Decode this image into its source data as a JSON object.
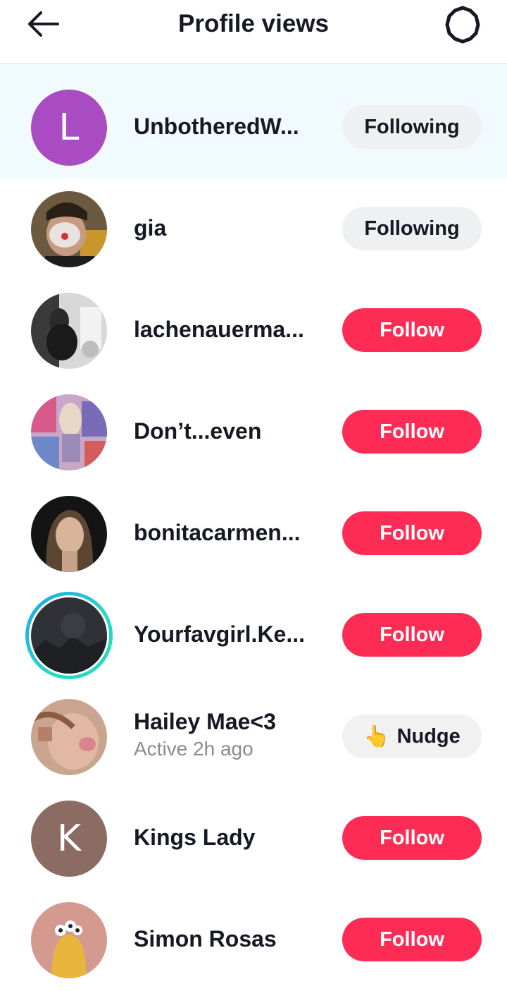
{
  "header": {
    "title": "Profile views",
    "back_icon": "back-arrow-icon",
    "settings_icon": "gear-icon"
  },
  "colors": {
    "follow": "#fe2c55",
    "following": "#eff0f1",
    "highlight": "#f1fafc"
  },
  "viewers": [
    {
      "name": "UnbotheredW...",
      "button": "Following",
      "avatar_letter": "L",
      "avatar_color": "#a94cc4"
    },
    {
      "name": "gia",
      "button": "Following"
    },
    {
      "name": "lachenauerma...",
      "button": "Follow"
    },
    {
      "name": "Don’t...even",
      "button": "Follow"
    },
    {
      "name": "bonitacarmen...",
      "button": "Follow"
    },
    {
      "name": "Yourfavgirl.Ke...",
      "button": "Follow"
    },
    {
      "name": "Hailey Mae<3",
      "status": "Active 2h ago",
      "button": "Nudge",
      "button_icon": "pointing-hand-icon"
    },
    {
      "name": "Kings Lady",
      "button": "Follow",
      "avatar_letter": "K",
      "avatar_color": "#8b6b62"
    },
    {
      "name": "Simon Rosas",
      "button": "Follow"
    }
  ]
}
